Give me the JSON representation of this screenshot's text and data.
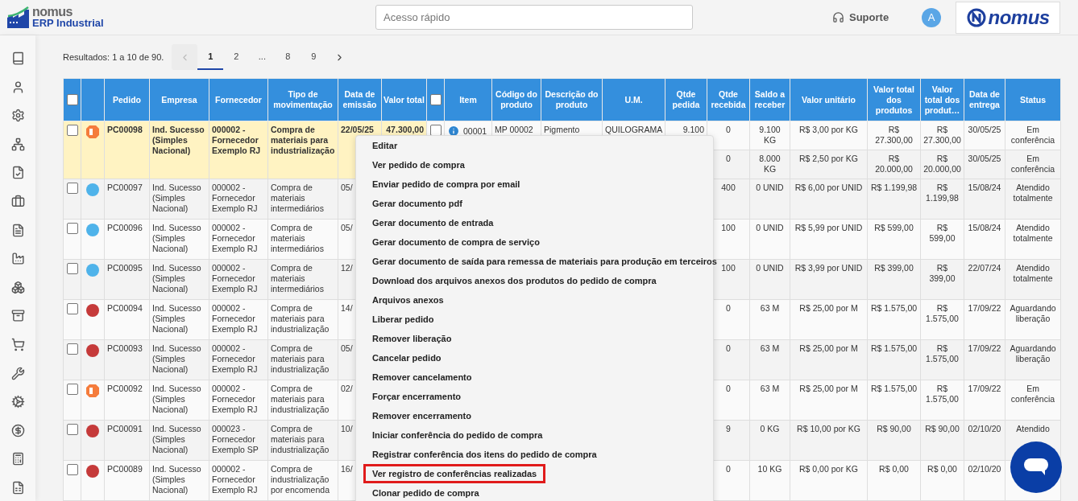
{
  "header": {
    "brand": "nomus",
    "product": "ERP Industrial",
    "search": {
      "placeholder": "Acesso rápido"
    },
    "support": "Suporte",
    "avatar": "A",
    "company_logo": "nomus"
  },
  "pagination": {
    "results": "Resultados: 1 a 10 de 90.",
    "prev_disabled": true,
    "pages": [
      {
        "label": "1",
        "selected": true
      },
      {
        "label": "2",
        "selected": false
      },
      {
        "label": "...",
        "selected": false
      },
      {
        "label": "8",
        "selected": false
      },
      {
        "label": "9",
        "selected": false
      }
    ]
  },
  "table": {
    "columns": [
      {
        "kind": "checkbox",
        "checked": false
      },
      {
        "kind": "blank"
      },
      {
        "kind": "text",
        "label": "Pedido"
      },
      {
        "kind": "text",
        "label": "Empresa"
      },
      {
        "kind": "text",
        "label": "Fornecedor"
      },
      {
        "kind": "text",
        "label": "Tipo de movimentação"
      },
      {
        "kind": "text",
        "label": "Data de emissão"
      },
      {
        "kind": "text",
        "label": "Valor total"
      },
      {
        "kind": "checkbox",
        "checked": false
      },
      {
        "kind": "text",
        "label": "Item"
      },
      {
        "kind": "text",
        "label": "Código do produto"
      },
      {
        "kind": "text",
        "label": "Descrição do produto"
      },
      {
        "kind": "text",
        "label": "U.M."
      },
      {
        "kind": "text",
        "label": "Qtde pedida"
      },
      {
        "kind": "text",
        "label": "Qtde recebida"
      },
      {
        "kind": "text",
        "label": "Saldo a receber"
      },
      {
        "kind": "text",
        "label": "Valor unitário"
      },
      {
        "kind": "text",
        "label": "Valor total dos produtos"
      },
      {
        "kind": "text",
        "label": "Valor total dos produt…"
      },
      {
        "kind": "text",
        "label": "Data de entrega"
      },
      {
        "kind": "text",
        "label": "Status"
      }
    ],
    "rows": [
      {
        "checked": false,
        "highlighted": true,
        "status_icon": {
          "kind": "partial",
          "color": "#f57c3c"
        },
        "pedido": "PC00098",
        "empresa": "Ind. Sucesso (Simples Nacional)",
        "fornecedor": "000002 - Fornecedor Exemplo RJ",
        "tipo": "Compra de materiais para industrialização",
        "data": "22/05/25",
        "valor": "47.300,00",
        "items": [
          {
            "checked": false,
            "item": "00001",
            "codigo": "MP 00002",
            "descricao": "Pigmento",
            "um": "QUILOGRAMA",
            "qtde_pedida": "9.100",
            "qtde_recebida": "0",
            "saldo": "9.100 KG",
            "valor_unitario": "R$ 3,00 por KG",
            "valor_total_produtos": "R$ 27.300,00",
            "valor_total": "R$ 27.300,00",
            "data_entrega": "30/05/25",
            "status": "Em conferência"
          },
          {
            "qtde_recebida": "0",
            "saldo": "8.000 KG",
            "valor_unitario": "R$ 2,50 por KG",
            "valor_total_produtos": "R$ 20.000,00",
            "valor_total": "R$ 20.000,00",
            "data_entrega": "30/05/25",
            "status": "Em conferência"
          }
        ]
      },
      {
        "checked": false,
        "highlighted": false,
        "status_icon": {
          "kind": "dot",
          "color": "#4fb3ea"
        },
        "pedido": "PC00097",
        "empresa": "Ind. Sucesso (Simples Nacional)",
        "fornecedor": "000002 - Fornecedor Exemplo RJ",
        "tipo": "Compra de materiais intermediários",
        "data": "05/",
        "items": [
          {
            "qtde_recebida": "400",
            "saldo": "0 UNID",
            "valor_unitario": "R$ 6,00 por UNID",
            "valor_total_produtos": "R$ 1.199,98",
            "valor_total": "R$ 1.199,98",
            "data_entrega": "15/08/24",
            "status": "Atendido totalmente"
          }
        ]
      },
      {
        "checked": false,
        "highlighted": false,
        "status_icon": {
          "kind": "dot",
          "color": "#4fb3ea"
        },
        "pedido": "PC00096",
        "empresa": "Ind. Sucesso (Simples Nacional)",
        "fornecedor": "000002 - Fornecedor Exemplo RJ",
        "tipo": "Compra de materiais intermediários",
        "data": "05/",
        "items": [
          {
            "qtde_recebida": "100",
            "saldo": "0 UNID",
            "valor_unitario": "R$ 5,99 por UNID",
            "valor_total_produtos": "R$ 599,00",
            "valor_total": "R$ 599,00",
            "data_entrega": "15/08/24",
            "status": "Atendido totalmente"
          }
        ]
      },
      {
        "checked": false,
        "highlighted": false,
        "status_icon": {
          "kind": "dot",
          "color": "#4fb3ea"
        },
        "pedido": "PC00095",
        "empresa": "Ind. Sucesso (Simples Nacional)",
        "fornecedor": "000002 - Fornecedor Exemplo RJ",
        "tipo": "Compra de materiais intermediários",
        "data": "12/",
        "items": [
          {
            "qtde_recebida": "100",
            "saldo": "0 UNID",
            "valor_unitario": "R$ 3,99 por UNID",
            "valor_total_produtos": "R$ 399,00",
            "valor_total": "R$ 399,00",
            "data_entrega": "22/07/24",
            "status": "Atendido totalmente"
          }
        ]
      },
      {
        "checked": false,
        "highlighted": false,
        "status_icon": {
          "kind": "dot",
          "color": "#c53a3a"
        },
        "pedido": "PC00094",
        "empresa": "Ind. Sucesso (Simples Nacional)",
        "fornecedor": "000002 - Fornecedor Exemplo RJ",
        "tipo": "Compra de materiais para industrialização",
        "data": "14/",
        "items": [
          {
            "qtde_recebida": "0",
            "saldo": "63 M",
            "valor_unitario": "R$ 25,00 por M",
            "valor_total_produtos": "R$ 1.575,00",
            "valor_total": "R$ 1.575,00",
            "data_entrega": "17/09/22",
            "status": "Aguardando liberação"
          }
        ]
      },
      {
        "checked": false,
        "highlighted": false,
        "status_icon": {
          "kind": "dot",
          "color": "#c53a3a"
        },
        "pedido": "PC00093",
        "empresa": "Ind. Sucesso (Simples Nacional)",
        "fornecedor": "000002 - Fornecedor Exemplo RJ",
        "tipo": "Compra de materiais para industrialização",
        "data": "05/",
        "items": [
          {
            "qtde_recebida": "0",
            "saldo": "63 M",
            "valor_unitario": "R$ 25,00 por M",
            "valor_total_produtos": "R$ 1.575,00",
            "valor_total": "R$ 1.575,00",
            "data_entrega": "17/09/22",
            "status": "Aguardando liberação"
          }
        ]
      },
      {
        "checked": false,
        "highlighted": false,
        "status_icon": {
          "kind": "partial",
          "color": "#f57c3c"
        },
        "pedido": "PC00092",
        "empresa": "Ind. Sucesso (Simples Nacional)",
        "fornecedor": "000002 - Fornecedor Exemplo RJ",
        "tipo": "Compra de materiais para industrialização",
        "data": "02/",
        "items": [
          {
            "qtde_recebida": "0",
            "saldo": "63 M",
            "valor_unitario": "R$ 25,00 por M",
            "valor_total_produtos": "R$ 1.575,00",
            "valor_total": "R$ 1.575,00",
            "data_entrega": "17/09/22",
            "status": "Em conferência"
          }
        ]
      },
      {
        "checked": false,
        "highlighted": false,
        "status_icon": {
          "kind": "dot",
          "color": "#c53a3a"
        },
        "pedido": "PC00091",
        "empresa": "Ind. Sucesso (Simples Nacional)",
        "fornecedor": "000023 - Fornecedor Exemplo SP",
        "tipo": "Compra de materiais para industrialização",
        "data": "10/",
        "items": [
          {
            "qtde_recebida": "9",
            "saldo": "0 KG",
            "valor_unitario": "R$ 10,00 por KG",
            "valor_total_produtos": "R$ 90,00",
            "valor_total": "R$ 90,00",
            "data_entrega": "02/10/20",
            "status": "Atendido"
          }
        ]
      },
      {
        "checked": false,
        "highlighted": false,
        "status_icon": {
          "kind": "dot",
          "color": "#c53a3a"
        },
        "pedido": "PC00089",
        "empresa": "Ind. Sucesso (Simples Nacional)",
        "fornecedor": "000002 - Fornecedor Exemplo RJ",
        "tipo": "Compra de industrialização por encomenda",
        "data": "16/",
        "items": [
          {
            "qtde_recebida": "0",
            "saldo": "10 KG",
            "valor_unitario": "R$ 0,00 por KG",
            "valor_total_produtos": "R$ 0,00",
            "valor_total": "R$ 0,00",
            "data_entrega": "02/10/20"
          }
        ]
      }
    ]
  },
  "context_menu": {
    "items": [
      {
        "label": "Editar",
        "highlighted": false
      },
      {
        "label": "Ver pedido de compra",
        "highlighted": false
      },
      {
        "label": "Enviar pedido de compra por email",
        "highlighted": false
      },
      {
        "label": "Gerar documento pdf",
        "highlighted": false
      },
      {
        "label": "Gerar documento de entrada",
        "highlighted": false
      },
      {
        "label": "Gerar documento de compra de serviço",
        "highlighted": false
      },
      {
        "label": "Gerar documento de saída para remessa de materiais para produção em terceiros",
        "highlighted": false
      },
      {
        "label": "Download dos arquivos anexos dos produtos do pedido de compra",
        "highlighted": false
      },
      {
        "label": "Arquivos anexos",
        "highlighted": false
      },
      {
        "label": "Liberar pedido",
        "highlighted": false
      },
      {
        "label": "Remover liberação",
        "highlighted": false
      },
      {
        "label": "Cancelar pedido",
        "highlighted": false
      },
      {
        "label": "Remover cancelamento",
        "highlighted": false
      },
      {
        "label": "Forçar encerramento",
        "highlighted": false
      },
      {
        "label": "Remover encerramento",
        "highlighted": false
      },
      {
        "label": "Iniciar conferência do pedido de compra",
        "highlighted": false
      },
      {
        "label": "Registrar conferência dos itens do pedido de compra",
        "highlighted": false
      },
      {
        "label": "Ver registro de conferências realizadas",
        "highlighted": true
      },
      {
        "label": "Clonar pedido de compra",
        "highlighted": false
      }
    ]
  }
}
